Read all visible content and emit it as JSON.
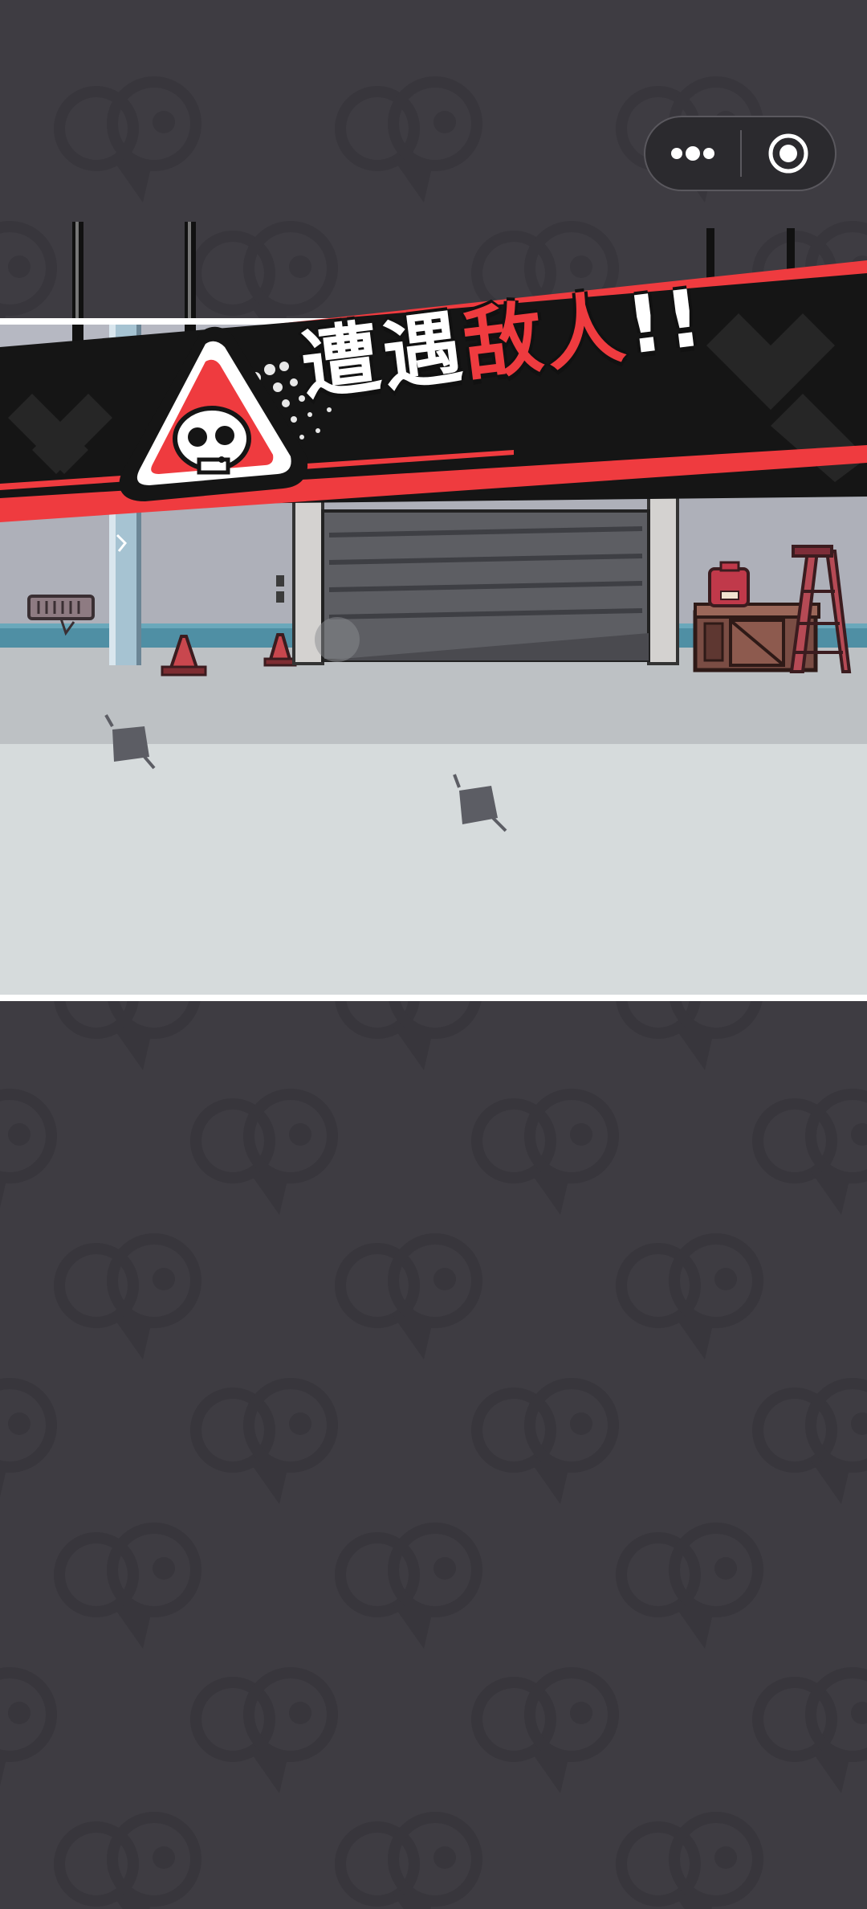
{
  "capsule": {
    "more_icon": "more-dots-icon",
    "close_icon": "target-circle-icon"
  },
  "banner": {
    "text_white": "遭遇",
    "text_red": "敌人",
    "text_end": "!!",
    "icon": "skull-warning-icon"
  },
  "colors": {
    "background": "#3e3c42",
    "banner_red": "#ef3b3f",
    "banner_black": "#151515",
    "wall": "#aeb0b9",
    "floor_back": "#bdc1c4",
    "floor_front": "#d6dbdc"
  }
}
